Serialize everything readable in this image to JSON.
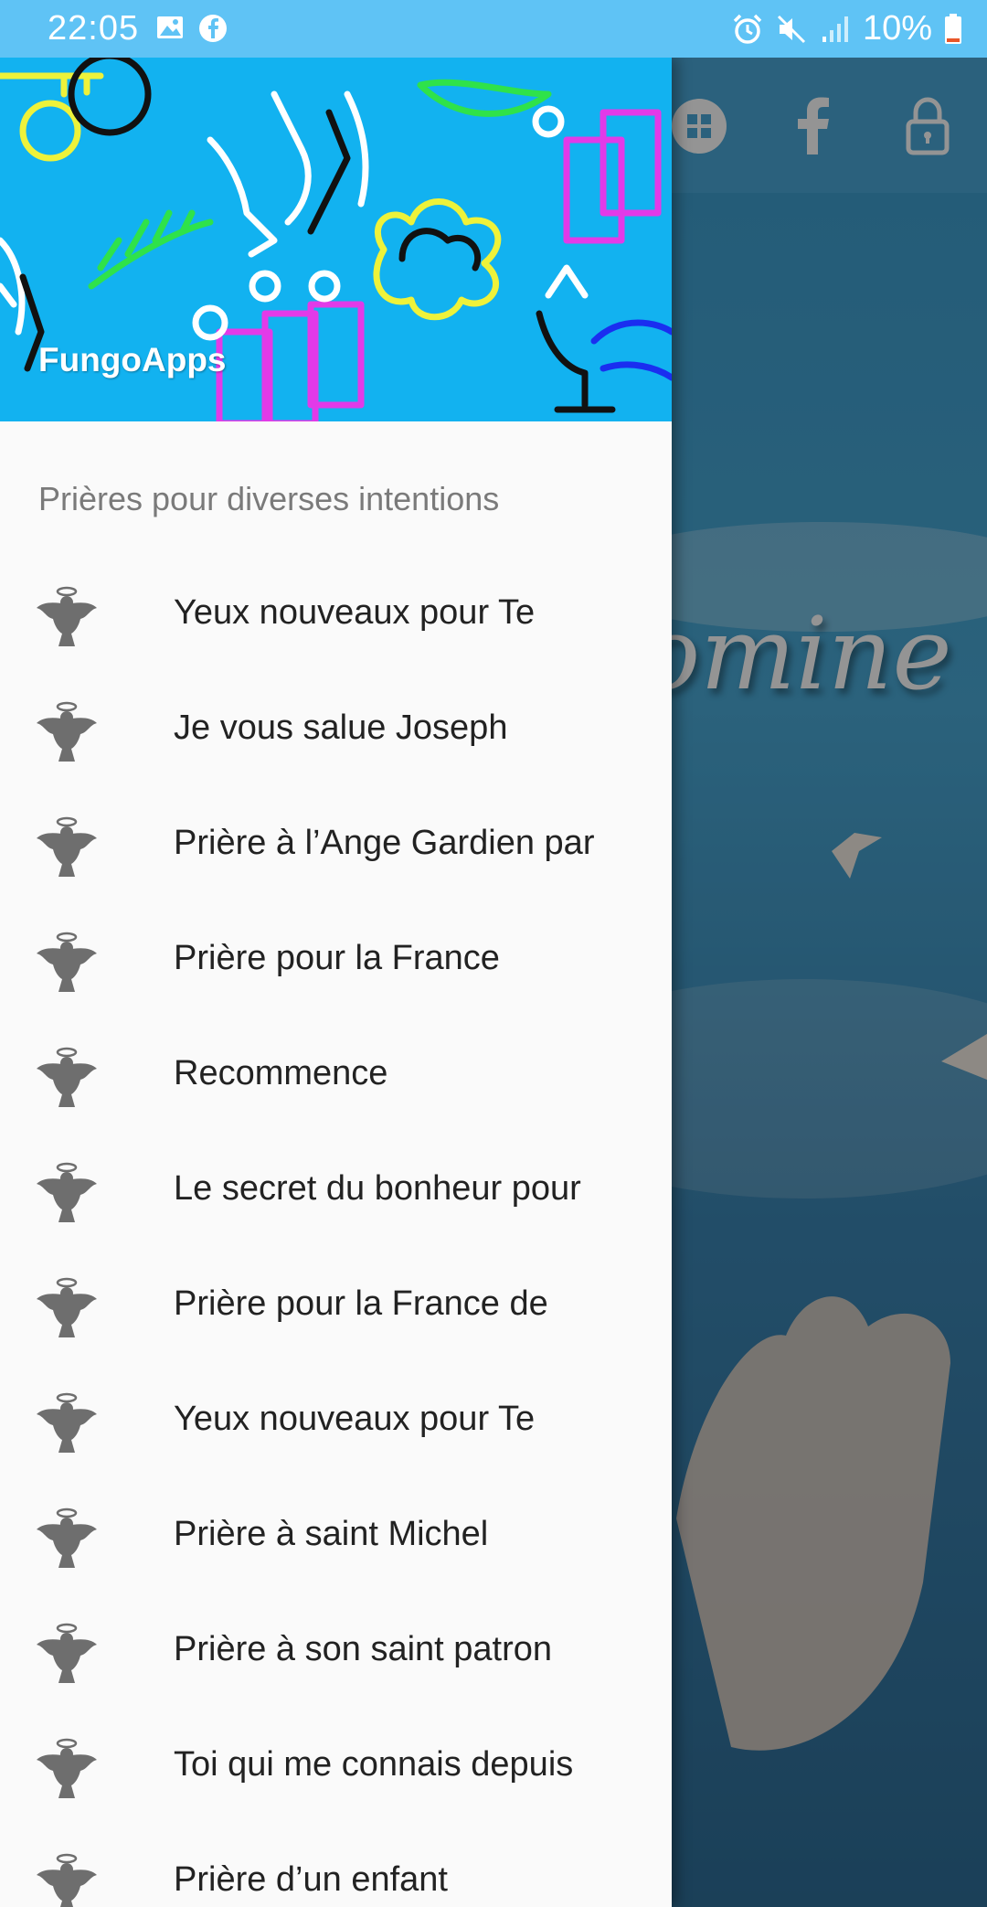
{
  "status_bar": {
    "time": "22:05",
    "battery": "10%",
    "icons": [
      "image-icon",
      "facebook-notification-icon",
      "alarm-icon",
      "mute-icon",
      "signal-icon",
      "battery-icon"
    ]
  },
  "background_app": {
    "title_fragment": "omine",
    "toolbar_icons": [
      "apps-icon",
      "facebook-icon",
      "lock-icon"
    ]
  },
  "drawer": {
    "header_title": "FungoApps",
    "section_title": "Prières pour diverses intentions",
    "items": [
      {
        "label": "Yeux nouveaux pour Te"
      },
      {
        "label": "Je vous salue Joseph"
      },
      {
        "label": "Prière à l’Ange Gardien par"
      },
      {
        "label": "Prière pour la France"
      },
      {
        "label": "Recommence"
      },
      {
        "label": "Le secret du bonheur pour"
      },
      {
        "label": "Prière pour la France de"
      },
      {
        "label": "Yeux nouveaux pour Te"
      },
      {
        "label": "Prière à saint Michel"
      },
      {
        "label": "Prière à son saint patron"
      },
      {
        "label": "Toi qui me connais depuis"
      },
      {
        "label": "Prière d’un enfant"
      }
    ]
  },
  "colors": {
    "status_bar": "#5fc3f5",
    "header": "#12b2f0",
    "drawer_bg": "#fafafa",
    "icon_gray": "#6e6e6e"
  }
}
